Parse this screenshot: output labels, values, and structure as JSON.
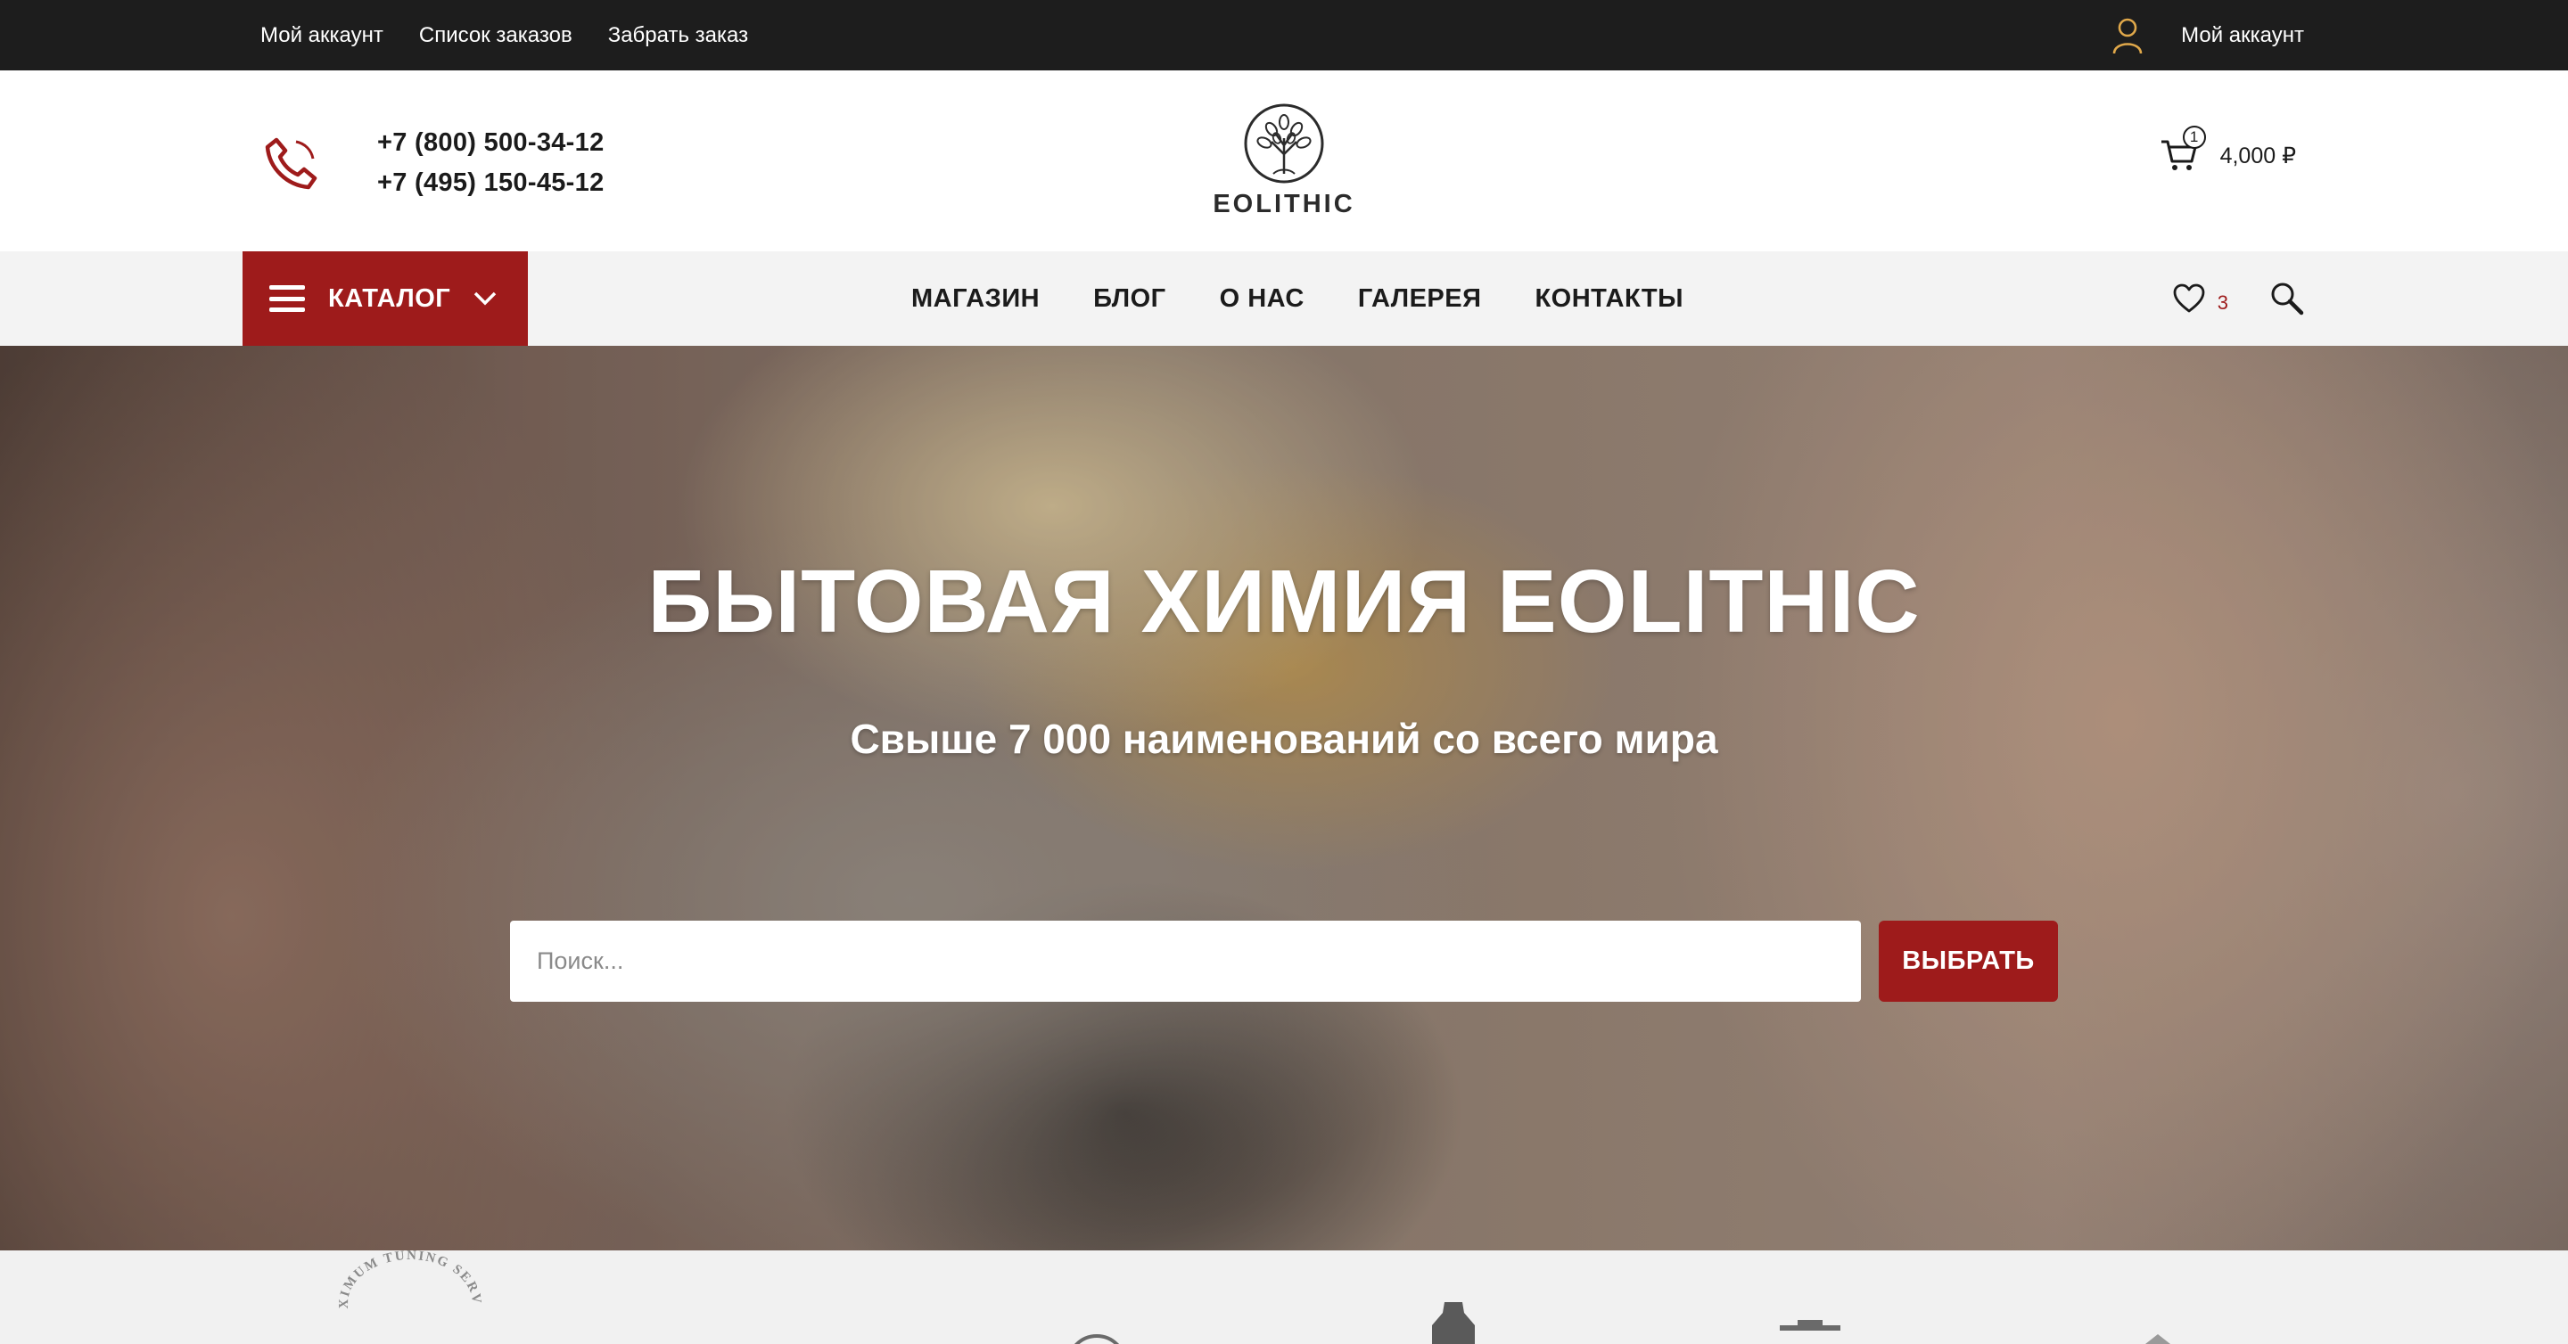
{
  "topbar": {
    "links": [
      "Мой аккаунт",
      "Список заказов",
      "Забрать заказ"
    ],
    "account_label": "Мой аккаунт"
  },
  "header": {
    "phones": [
      "+7 (800) 500-34-12",
      "+7 (495) 150-45-12"
    ],
    "logo_text": "EOLITHIC",
    "cart_count": "1",
    "cart_total": "4,000 ₽"
  },
  "nav": {
    "catalog_label": "КАТАЛОГ",
    "menu": [
      "МАГАЗИН",
      "БЛОГ",
      "О НАС",
      "ГАЛЕРЕЯ",
      "КОНТАКТЫ"
    ],
    "wishlist_count": "3"
  },
  "hero": {
    "title": "БЫТОВАЯ ХИМИЯ EOLITHIC",
    "subtitle": "Свыше 7 000 наименований со всего мира",
    "search_placeholder": "Поиск...",
    "button_label": "ВЫБРАТЬ"
  },
  "brands": {
    "first_logo_text": "MAXIMUM TUNING SERVICE"
  },
  "colors": {
    "accent": "#9e1b1b",
    "topbar": "#1d1d1d",
    "nav_bg": "#f3f3f3",
    "user_icon": "#e0a84a"
  },
  "icons": [
    "user-icon",
    "phone-icon",
    "logo-tree-icon",
    "cart-icon",
    "hamburger-icon",
    "chevron-down-icon",
    "heart-icon",
    "search-icon"
  ]
}
